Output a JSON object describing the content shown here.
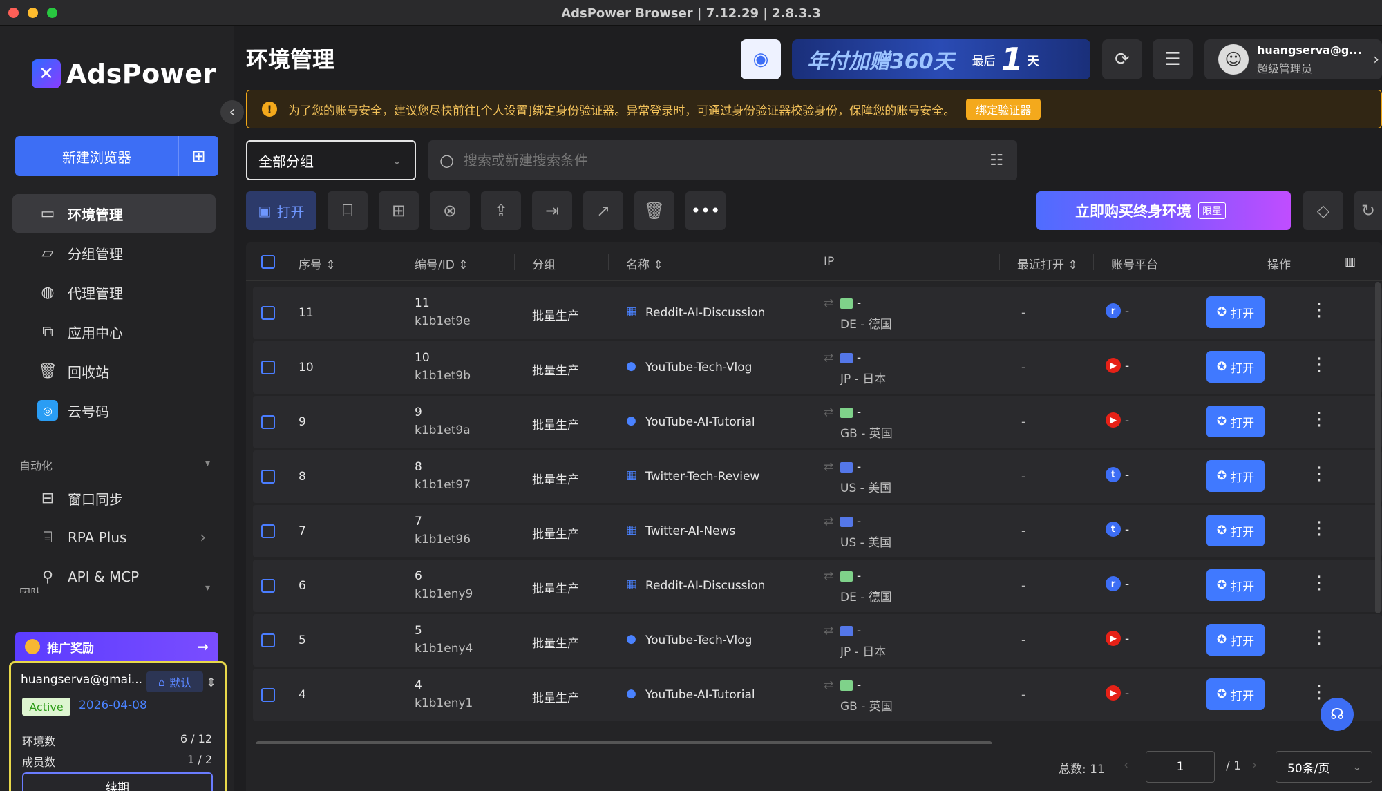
{
  "window": {
    "title": "AdsPower Browser | 7.12.29 | 2.8.3.3"
  },
  "brand": {
    "name": "AdsPower",
    "accent": "#3d6ef5"
  },
  "sidebar": {
    "new_browser": "新建浏览器",
    "items": [
      {
        "label": "环境管理",
        "icon": "browser-window-icon",
        "active": true
      },
      {
        "label": "分组管理",
        "icon": "folder-icon"
      },
      {
        "label": "代理管理",
        "icon": "proxy-globe-icon"
      },
      {
        "label": "应用中心",
        "icon": "puzzle-icon"
      },
      {
        "label": "回收站",
        "icon": "trash-icon"
      },
      {
        "label": "云号码",
        "icon": "cloud-phone-icon"
      }
    ],
    "automation_label": "自动化",
    "automation_items": [
      {
        "label": "窗口同步",
        "icon": "window-sync-icon"
      },
      {
        "label": "RPA Plus",
        "icon": "robot-icon"
      },
      {
        "label": "API & MCP",
        "icon": "api-plug-icon"
      }
    ],
    "team_label": "团队",
    "promo": "推广奖励",
    "account": {
      "email": "huangserva@gmai...",
      "default_label": "默认",
      "status": "Active",
      "expiry": "2026-04-08",
      "env_label": "环境数",
      "env_value": "6 / 12",
      "member_label": "成员数",
      "member_value": "1 / 2",
      "renew": "续期"
    }
  },
  "header": {
    "title": "环境管理",
    "banner_main": "年付加赠360天",
    "banner_last": "最后",
    "banner_days": "1",
    "banner_day": "天",
    "user_name": "huangserva@g...",
    "user_role": "超级管理员"
  },
  "warning": {
    "text": "为了您的账号安全，建议您尽快前往[个人设置]绑定身份验证器。异常登录时，可通过身份验证器校验身份，保障您的账号安全。",
    "button": "绑定验证器"
  },
  "filters": {
    "group": "全部分组",
    "search_placeholder": "搜索或新建搜索条件"
  },
  "toolbar": {
    "open": "打开",
    "buy": "立即购买终身环境",
    "buy_tag": "限量"
  },
  "table": {
    "headers": [
      "序号",
      "编号/ID",
      "分组",
      "名称",
      "IP",
      "最近打开",
      "账号平台",
      "操作"
    ],
    "open_label": "打开",
    "rows": [
      {
        "seq": "11",
        "num": "11",
        "id": "k1b1et9e",
        "group": "批量生产",
        "name": "Reddit-AI-Discussion",
        "os": "windows",
        "ip_dash": "-",
        "ip": "DE - 德国",
        "last": "-",
        "platform": "reddit",
        "plat_dash": "-"
      },
      {
        "seq": "10",
        "num": "10",
        "id": "k1b1et9b",
        "group": "批量生产",
        "name": "YouTube-Tech-Vlog",
        "os": "apple",
        "ip_dash": "-",
        "ip": "JP - 日本",
        "last": "-",
        "platform": "youtube",
        "plat_dash": "-"
      },
      {
        "seq": "9",
        "num": "9",
        "id": "k1b1et9a",
        "group": "批量生产",
        "name": "YouTube-AI-Tutorial",
        "os": "apple",
        "ip_dash": "-",
        "ip": "GB - 英国",
        "last": "-",
        "platform": "youtube",
        "plat_dash": "-"
      },
      {
        "seq": "8",
        "num": "8",
        "id": "k1b1et97",
        "group": "批量生产",
        "name": "Twitter-Tech-Review",
        "os": "windows",
        "ip_dash": "-",
        "ip": "US - 美国",
        "last": "-",
        "platform": "twitter",
        "plat_dash": "-"
      },
      {
        "seq": "7",
        "num": "7",
        "id": "k1b1et96",
        "group": "批量生产",
        "name": "Twitter-AI-News",
        "os": "windows",
        "ip_dash": "-",
        "ip": "US - 美国",
        "last": "-",
        "platform": "twitter",
        "plat_dash": "-"
      },
      {
        "seq": "6",
        "num": "6",
        "id": "k1b1eny9",
        "group": "批量生产",
        "name": "Reddit-AI-Discussion",
        "os": "windows",
        "ip_dash": "-",
        "ip": "DE - 德国",
        "last": "-",
        "platform": "reddit",
        "plat_dash": "-"
      },
      {
        "seq": "5",
        "num": "5",
        "id": "k1b1eny4",
        "group": "批量生产",
        "name": "YouTube-Tech-Vlog",
        "os": "apple",
        "ip_dash": "-",
        "ip": "JP - 日本",
        "last": "-",
        "platform": "youtube",
        "plat_dash": "-"
      },
      {
        "seq": "4",
        "num": "4",
        "id": "k1b1eny1",
        "group": "批量生产",
        "name": "YouTube-AI-Tutorial",
        "os": "apple",
        "ip_dash": "-",
        "ip": "GB - 英国",
        "last": "-",
        "platform": "youtube",
        "plat_dash": "-"
      }
    ]
  },
  "pagination": {
    "total": "总数: 11",
    "page": "1",
    "pages": "/ 1",
    "page_size": "50条/页"
  }
}
